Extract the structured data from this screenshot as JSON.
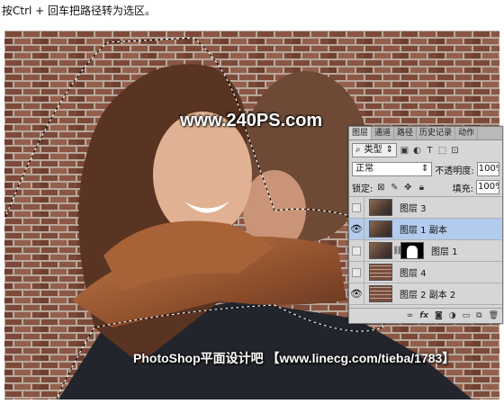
{
  "instruction": "按Ctrl + 回车把路径转为选区。",
  "watermark_top": "www.240PS.com",
  "watermark_bottom": "PhotoShop平面设计吧 【www.linecg.com/tieba/1783】",
  "panel": {
    "tabs": [
      "图层",
      "通道",
      "路径",
      "历史记录",
      "动作"
    ],
    "active_tab": "图层",
    "filter_kind": "类型",
    "blend_mode": "正常",
    "opacity_label": "不透明度:",
    "opacity_value": "100%",
    "lock_label": "锁定:",
    "fill_label": "填充:",
    "fill_value": "100%",
    "layers": [
      {
        "name": "图层 3",
        "visible": false,
        "selected": false,
        "thumb": "photo"
      },
      {
        "name": "图层 1 副本",
        "visible": true,
        "selected": true,
        "thumb": "photo"
      },
      {
        "name": "图层 1",
        "visible": false,
        "selected": false,
        "thumb": "photo",
        "mask": true
      },
      {
        "name": "图层 4",
        "visible": false,
        "selected": false,
        "thumb": "brick"
      },
      {
        "name": "图层 2 副本 2",
        "visible": true,
        "selected": false,
        "thumb": "brick"
      }
    ],
    "footer_icons": [
      "link-icon",
      "fx-icon",
      "mask-icon",
      "adjustment-icon",
      "folder-icon",
      "new-layer-icon",
      "trash-icon"
    ]
  }
}
